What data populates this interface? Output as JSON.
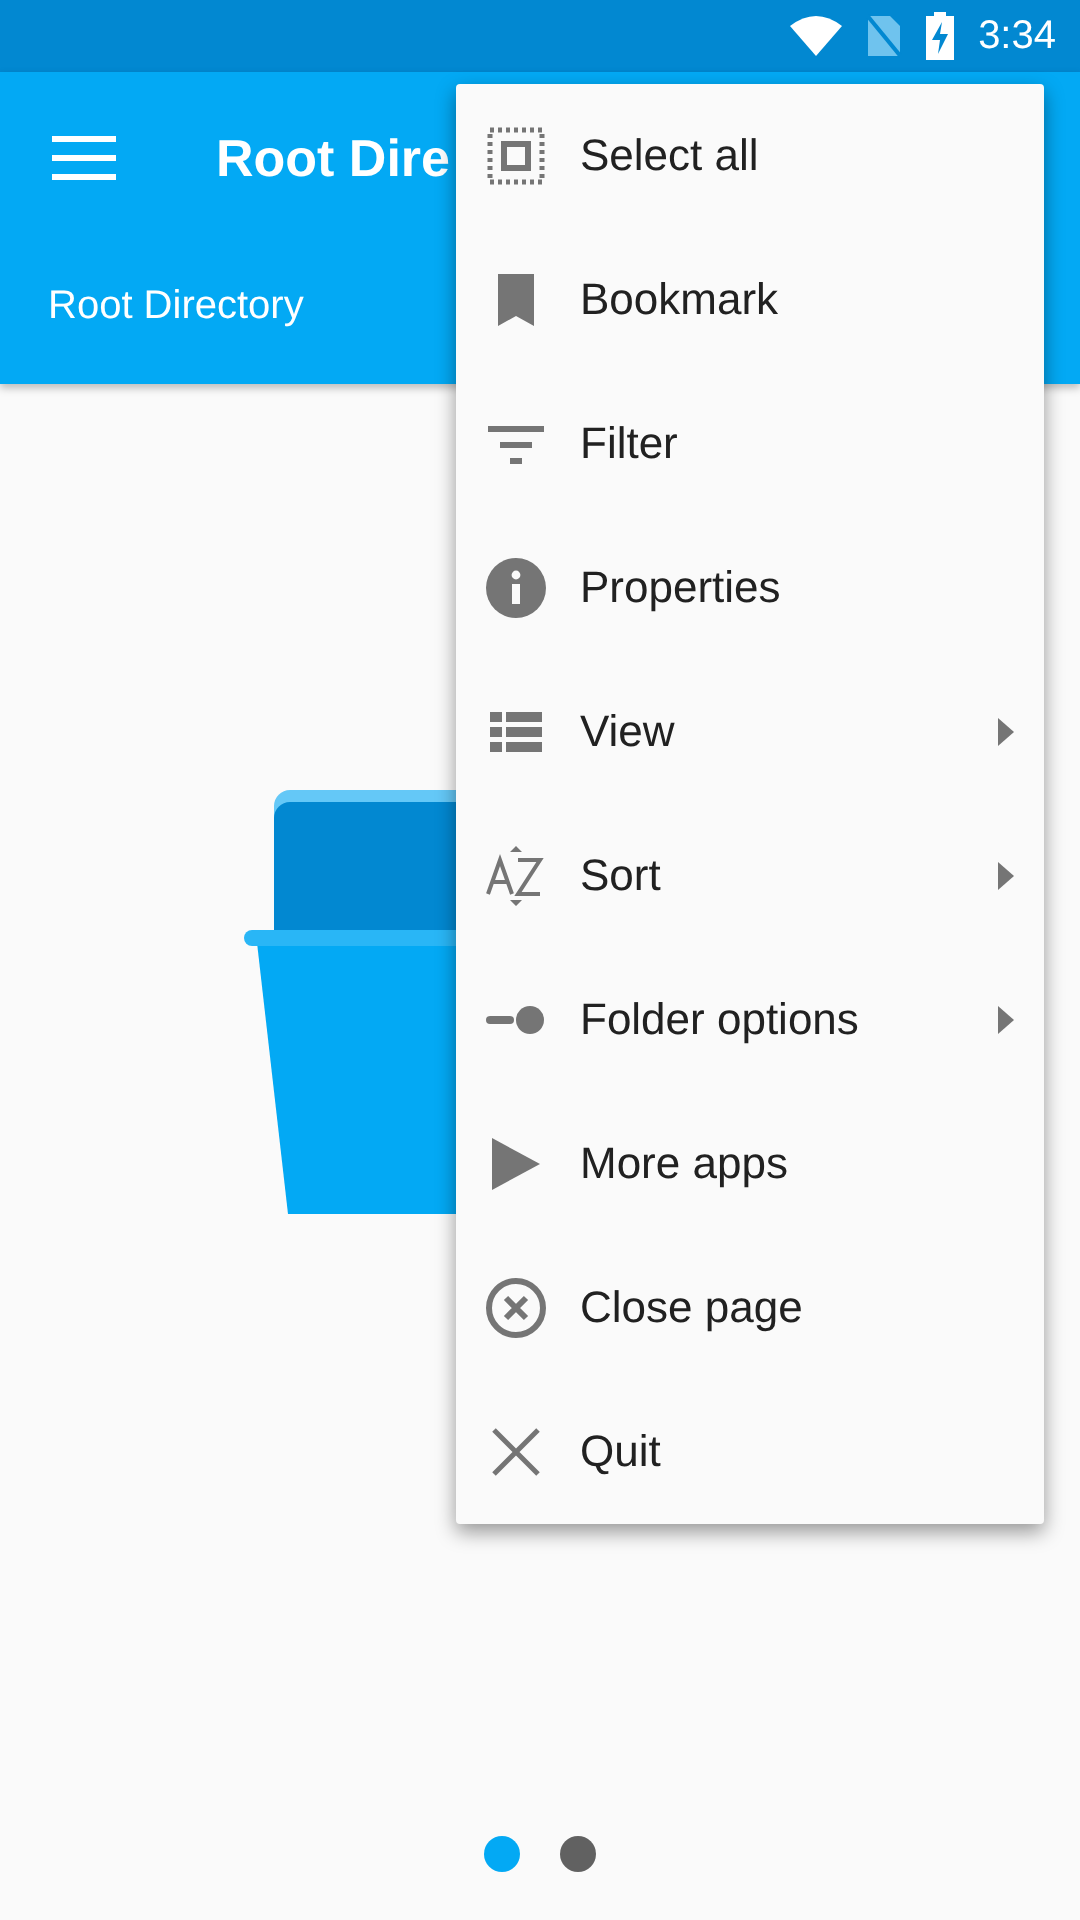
{
  "status_bar": {
    "time": "3:34"
  },
  "app_bar": {
    "title": "Root Dire",
    "subtitle": "Root Directory"
  },
  "menu": {
    "items": [
      {
        "label": "Select all",
        "has_submenu": false
      },
      {
        "label": "Bookmark",
        "has_submenu": false
      },
      {
        "label": "Filter",
        "has_submenu": false
      },
      {
        "label": "Properties",
        "has_submenu": false
      },
      {
        "label": "View",
        "has_submenu": true
      },
      {
        "label": "Sort",
        "has_submenu": true
      },
      {
        "label": "Folder options",
        "has_submenu": true
      },
      {
        "label": "More apps",
        "has_submenu": false
      },
      {
        "label": "Close page",
        "has_submenu": false
      },
      {
        "label": "Quit",
        "has_submenu": false
      }
    ]
  },
  "pager": [
    {
      "selected": true
    },
    {
      "selected": false
    }
  ]
}
